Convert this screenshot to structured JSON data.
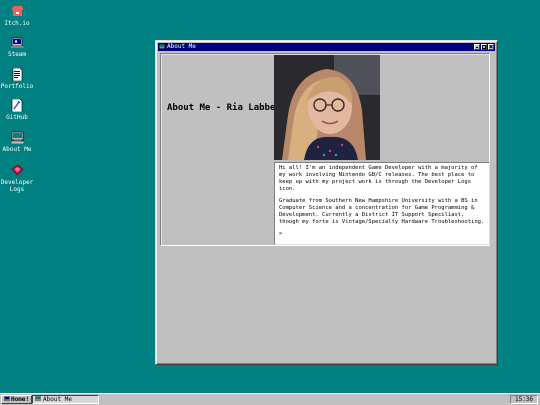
{
  "desktop": {
    "icons": [
      {
        "label": "Itch.io",
        "icon": "itchio-icon"
      },
      {
        "label": "Steam",
        "icon": "steam-icon"
      },
      {
        "label": "Portfolio",
        "icon": "document-icon"
      },
      {
        "label": "GitHub",
        "icon": "github-icon"
      },
      {
        "label": "About Me",
        "icon": "computer-icon"
      },
      {
        "label": "Developer\nLogs",
        "icon": "devlogs-icon"
      }
    ]
  },
  "window": {
    "title": "About Me",
    "heading": "About Me - Ria Labbe",
    "photo_alt": "Photo of Ria Labbe",
    "bio": {
      "paragraph1": "Hi all! I'm an independent Game Developer with a majority of my work involving Nintendo GB/C releases. The best place to keep up with my project work is through the Developer Logs icon.",
      "paragraph2": "Graduate from Southern New Hampshire University with a BS in Computer Science and a concentration for Game Programming & Development. Currently a District IT Support Speciliast, though my forte is Vintage/Specialty Hardware Troubleshooting.",
      "prompt": ">"
    }
  },
  "taskbar": {
    "start_label": "Home!",
    "task_label": "About Me",
    "clock": "15:36"
  },
  "colors": {
    "desktop": "#008080",
    "titlebar": "#000080",
    "window": "#c0c0c0"
  }
}
